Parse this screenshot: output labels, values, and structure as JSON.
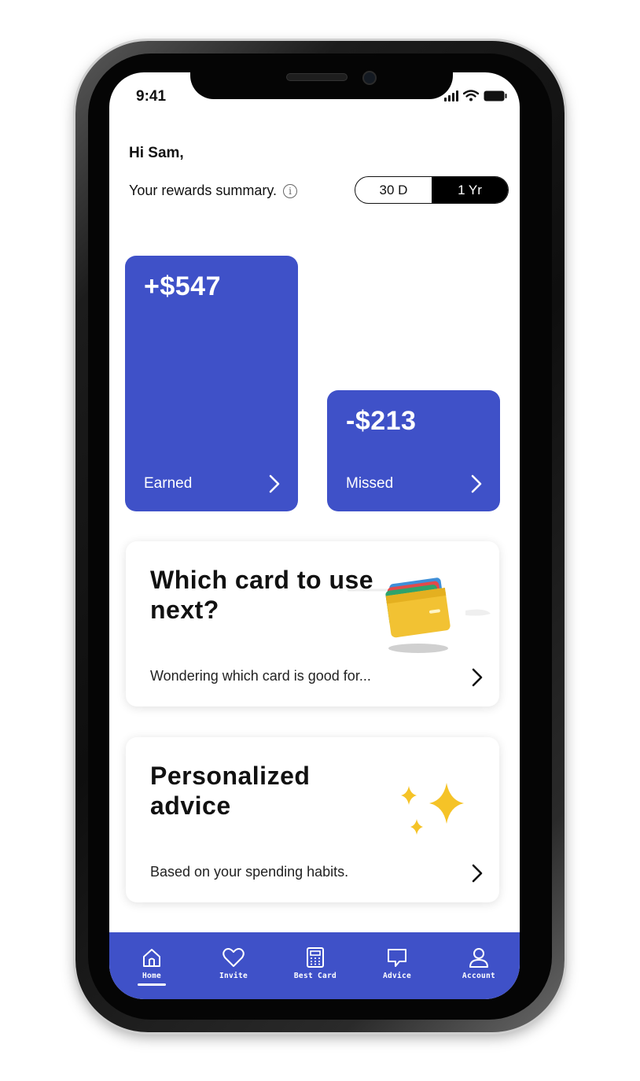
{
  "status_bar": {
    "time": "9:41"
  },
  "header": {
    "greeting": "Hi Sam,",
    "summary_label": "Your rewards summary.",
    "info_icon": "i",
    "toggle_options": [
      "30 D",
      "1 Yr"
    ],
    "toggle_selected": "1 Yr"
  },
  "stats": {
    "earned": {
      "amount": "+$547",
      "label": "Earned"
    },
    "missed": {
      "amount": "-$213",
      "label": "Missed"
    }
  },
  "cards": {
    "which_card": {
      "title": "Which card to use next?",
      "subtitle": "Wondering which card is good for...",
      "icon": "wallet-icon"
    },
    "advice": {
      "title": "Personalized advice",
      "subtitle": "Based on your spending habits.",
      "icon": "sparkles-icon"
    }
  },
  "tabbar": {
    "tabs": [
      {
        "label": "Home",
        "icon": "home-icon"
      },
      {
        "label": "Invite",
        "icon": "heart-icon"
      },
      {
        "label": "Best Card",
        "icon": "calculator-icon"
      },
      {
        "label": "Advice",
        "icon": "chat-bubble-icon"
      },
      {
        "label": "Account",
        "icon": "person-icon"
      }
    ],
    "active": "Home"
  },
  "colors": {
    "accent": "#3f51c8",
    "toggle_active_bg": "#000000",
    "text": "#111111"
  }
}
